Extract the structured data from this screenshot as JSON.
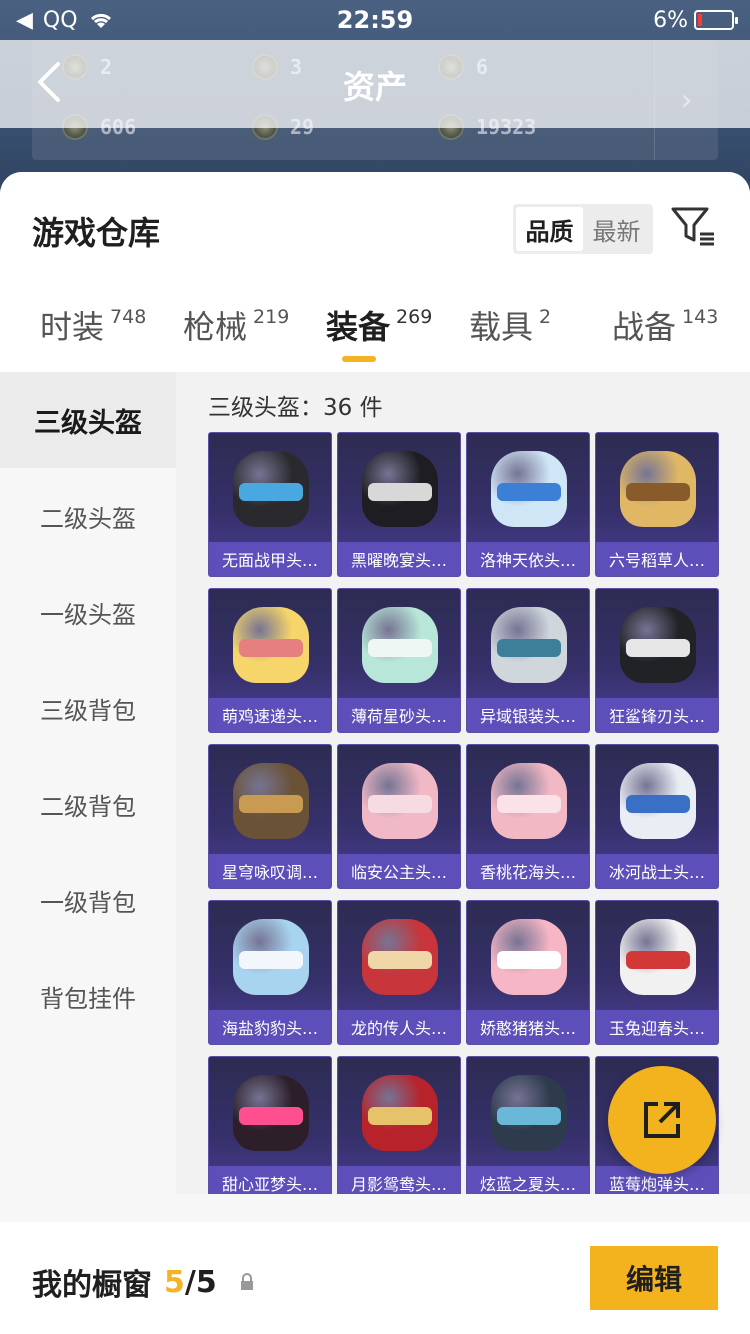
{
  "status_bar": {
    "carrier": "QQ",
    "time": "22:59",
    "battery": "6%"
  },
  "nav": {
    "title": "资产"
  },
  "assets": [
    {
      "icon": "ticket-icon",
      "value": "2"
    },
    {
      "icon": "coin-icon",
      "value": "3"
    },
    {
      "icon": "medal-icon",
      "value": "6"
    },
    {
      "icon": "card-icon",
      "value": "606"
    },
    {
      "icon": "token-icon",
      "value": "29"
    },
    {
      "icon": "gold-coin-icon",
      "value": "19323"
    }
  ],
  "page_title": "游戏仓库",
  "sort": {
    "options": [
      "品质",
      "最新"
    ],
    "selected": "品质"
  },
  "tabs": [
    {
      "label": "时装",
      "count": "748"
    },
    {
      "label": "枪械",
      "count": "219"
    },
    {
      "label": "装备",
      "count": "269",
      "active": true
    },
    {
      "label": "载具",
      "count": "2"
    },
    {
      "label": "战备",
      "count": "143"
    }
  ],
  "sidebar": [
    {
      "label": "三级头盔",
      "active": true
    },
    {
      "label": "二级头盔"
    },
    {
      "label": "一级头盔"
    },
    {
      "label": "三级背包"
    },
    {
      "label": "二级背包"
    },
    {
      "label": "一级背包"
    },
    {
      "label": "背包挂件"
    }
  ],
  "category_count": "三级头盔：36 件",
  "items": [
    {
      "name": "无面战甲头…",
      "color": "#2a2a2e",
      "accent": "#4aa8e0"
    },
    {
      "name": "黑曜晚宴头…",
      "color": "#1e1e22",
      "accent": "#d8d8d8"
    },
    {
      "name": "洛神天依头…",
      "color": "#cfe6f7",
      "accent": "#3c7fd6"
    },
    {
      "name": "六号稻草人…",
      "color": "#e0b865",
      "accent": "#8a5b2a"
    },
    {
      "name": "萌鸡速递头…",
      "color": "#f6d66a",
      "accent": "#e67f7f"
    },
    {
      "name": "薄荷星砂头…",
      "color": "#b8e6d8",
      "accent": "#eef7f3"
    },
    {
      "name": "异域银装头…",
      "color": "#cfd6dc",
      "accent": "#3d7f98"
    },
    {
      "name": "狂鲨锋刃头…",
      "color": "#202226",
      "accent": "#e6e6e6"
    },
    {
      "name": "星穹咏叹调…",
      "color": "#6a5236",
      "accent": "#c99a52"
    },
    {
      "name": "临安公主头…",
      "color": "#f1b9c6",
      "accent": "#f7dbe2"
    },
    {
      "name": "香桃花海头…",
      "color": "#f2b8c4",
      "accent": "#fbe2e8"
    },
    {
      "name": "冰河战士头…",
      "color": "#e9eef5",
      "accent": "#3a6fc6"
    },
    {
      "name": "海盐豹豹头…",
      "color": "#a8d4ef",
      "accent": "#f3f7fb"
    },
    {
      "name": "龙的传人头…",
      "color": "#c8353a",
      "accent": "#f0d7a8"
    },
    {
      "name": "娇憨猪猪头…",
      "color": "#f6b6c6",
      "accent": "#ffffff"
    },
    {
      "name": "玉兔迎春头…",
      "color": "#f1f1f1",
      "accent": "#d23838"
    },
    {
      "name": "甜心亚梦头…",
      "color": "#2d1f2a",
      "accent": "#ff4f8f"
    },
    {
      "name": "月影鸳鸯头…",
      "color": "#b8222a",
      "accent": "#e6c26a"
    },
    {
      "name": "炫蓝之夏头…",
      "color": "#2e3b4d",
      "accent": "#6ab8d8"
    },
    {
      "name": "蓝莓炮弹头…",
      "color": "#3a4a8a",
      "accent": "#7ab0ff"
    }
  ],
  "showcase": {
    "label": "我的橱窗",
    "current": "5",
    "total": "5"
  },
  "edit_button": "编辑",
  "colors": {
    "accent": "#f3b31f",
    "item_bar": "#5d4fb9"
  }
}
